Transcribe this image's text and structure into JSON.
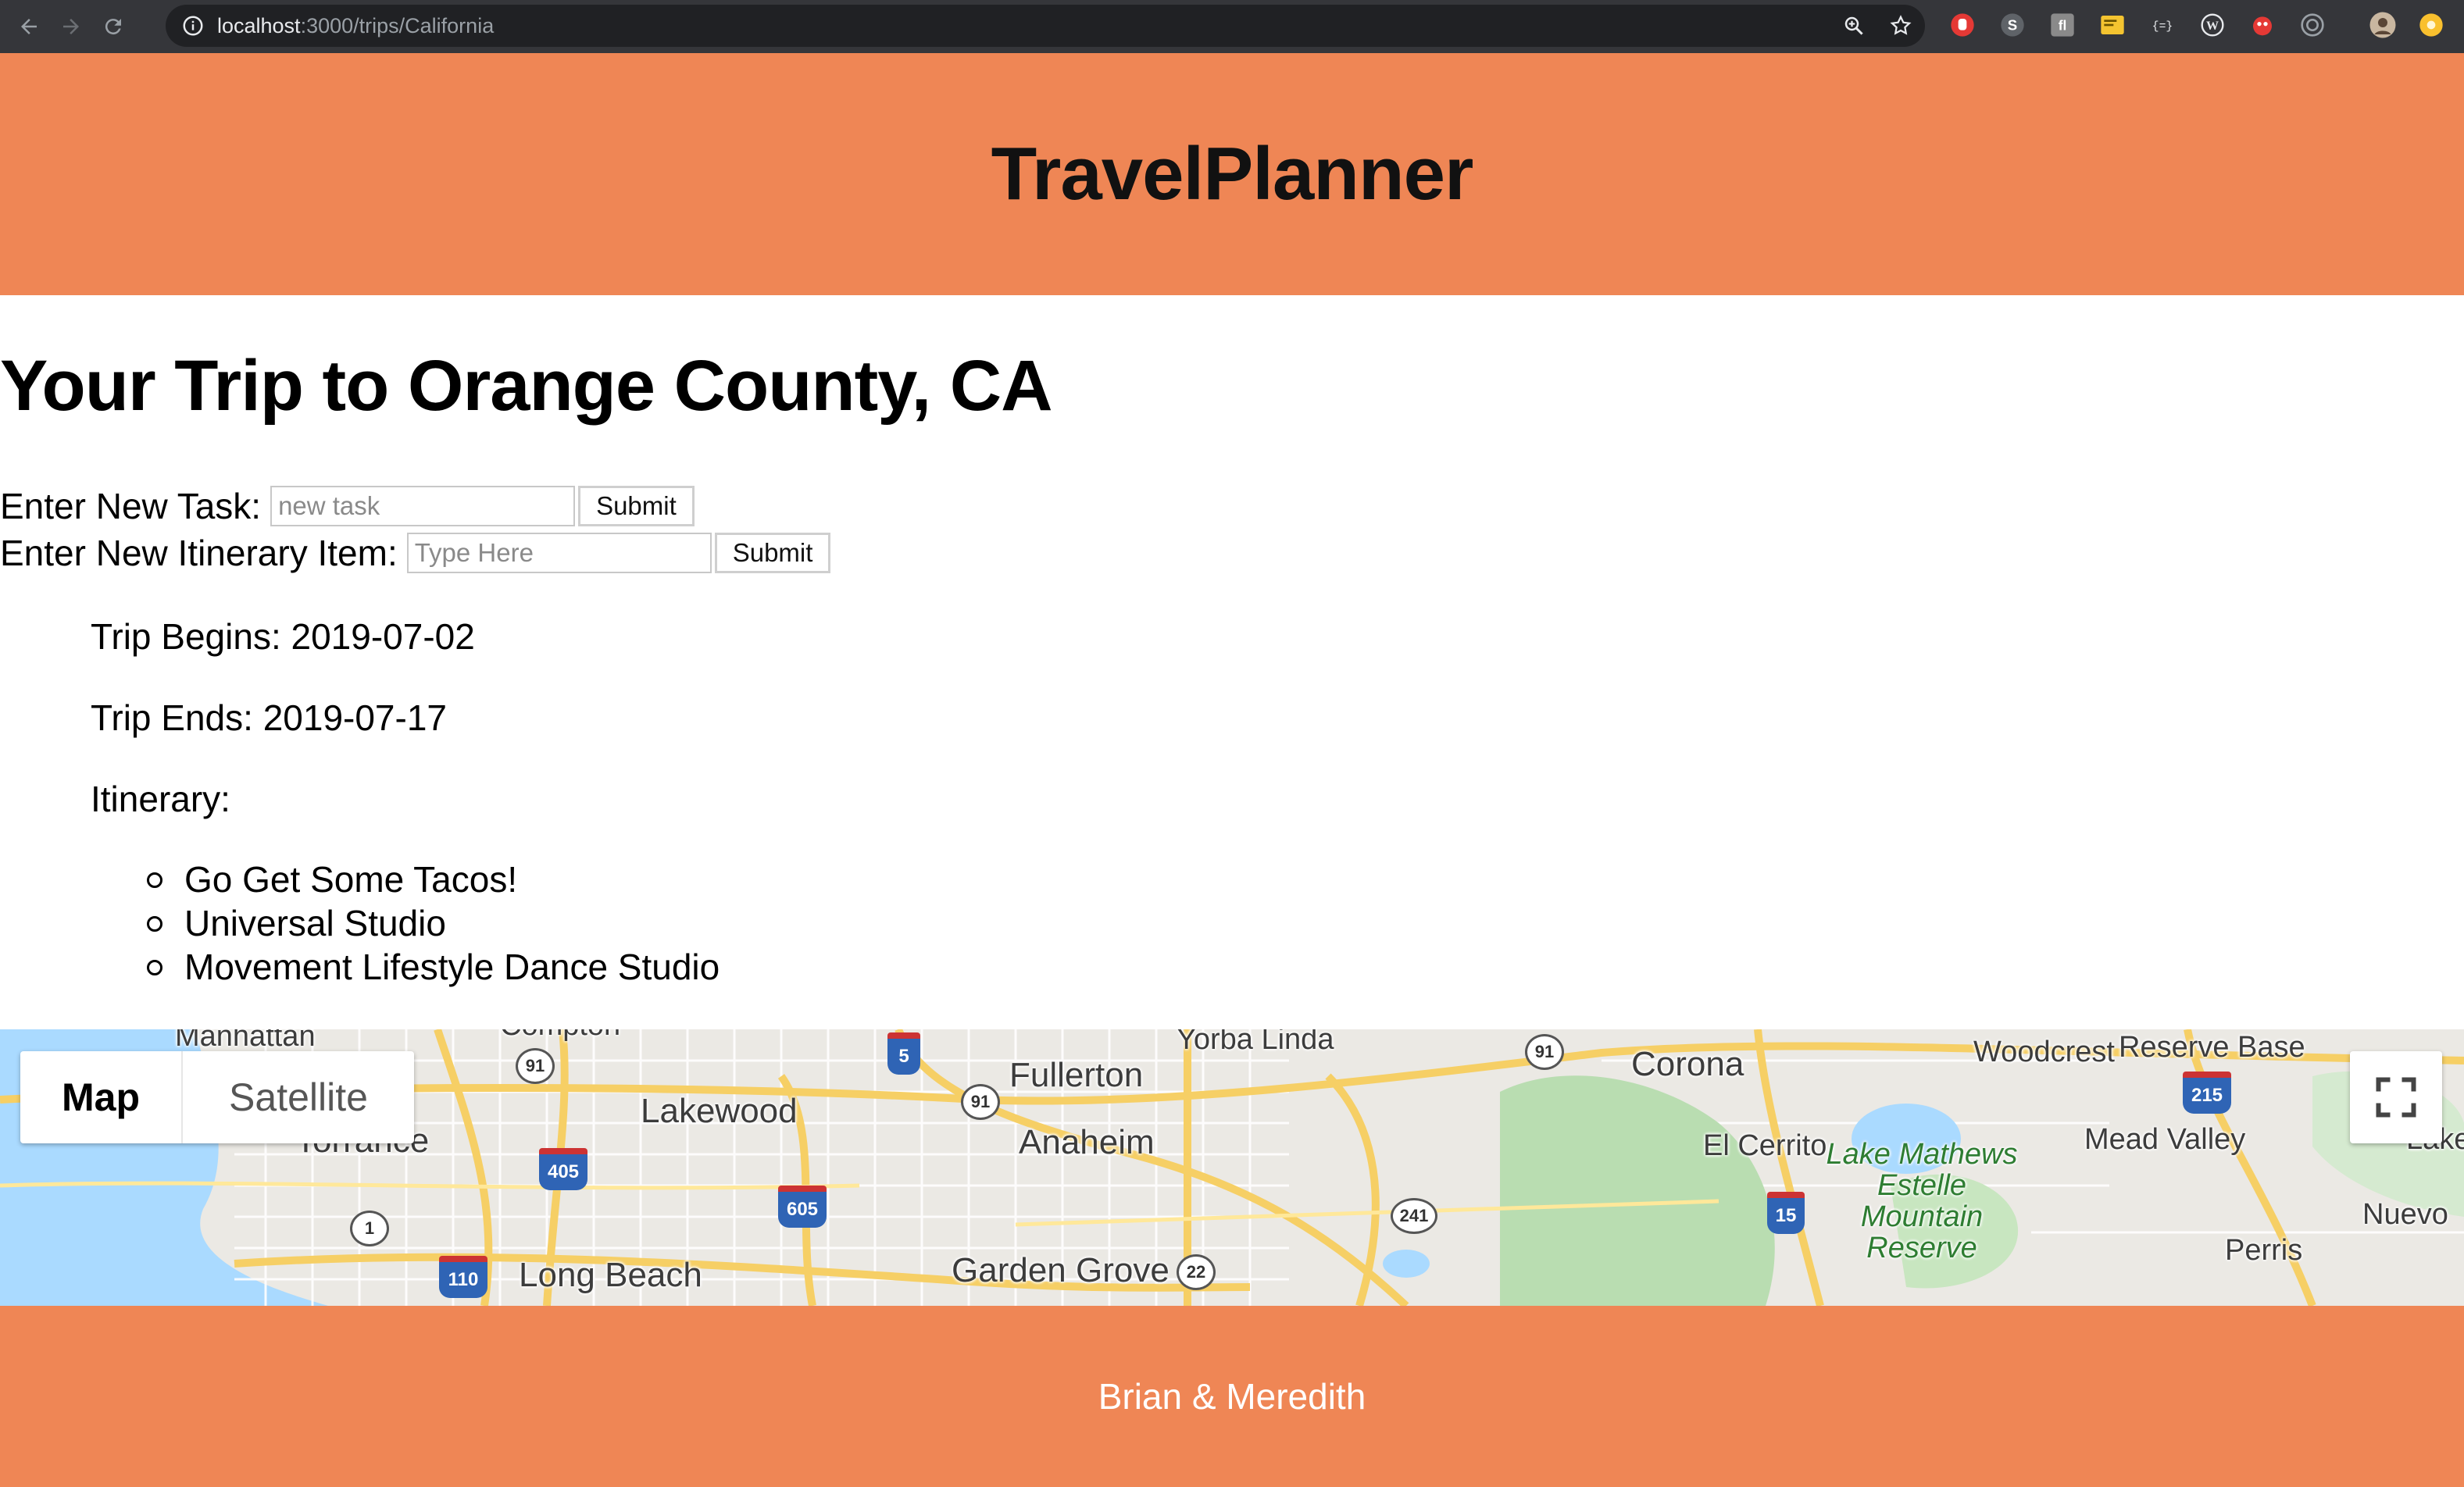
{
  "browser": {
    "url_host": "localhost",
    "url_path": ":3000/trips/California",
    "extensions": [
      {
        "icon": "red-stop-extension-icon",
        "color": "#e53935"
      },
      {
        "icon": "s-extension-icon",
        "color": "#5f6368",
        "label": "S"
      },
      {
        "icon": "fl-extension-icon",
        "color": "#8a8a8a"
      },
      {
        "icon": "yellow-note-extension-icon",
        "color": "#f4c430"
      },
      {
        "icon": "json-extension-icon",
        "color": "#9aa0a6",
        "label": "{=}"
      },
      {
        "icon": "w-extension-icon",
        "color": "#9aa0a6",
        "label": "W"
      },
      {
        "icon": "red-bug-extension-icon",
        "color": "#e53935"
      },
      {
        "icon": "target-extension-icon",
        "color": "#9aa0a6"
      },
      {
        "icon": "profile-avatar-icon",
        "color": "#c9b7a0"
      },
      {
        "icon": "yellow-circle-extension-icon",
        "color": "#f9c02e"
      }
    ]
  },
  "header": {
    "brand": "TravelPlanner",
    "color": "#ef8655"
  },
  "trip": {
    "title": "Your Trip to Orange County, CA",
    "task_form": {
      "label": "Enter New Task:",
      "placeholder": "new task",
      "submit_label": "Submit"
    },
    "itinerary_form": {
      "label": "Enter New Itinerary Item:",
      "placeholder": "Type Here",
      "submit_label": "Submit"
    },
    "begins": "Trip Begins: 2019-07-02",
    "ends": "Trip Ends: 2019-07-17",
    "itinerary_heading": "Itinerary:",
    "itinerary": [
      "Go Get Some Tacos!",
      "Universal Studio",
      "Movement Lifestyle Dance Studio"
    ]
  },
  "map": {
    "type_map_label": "Map",
    "type_satellite_label": "Satellite",
    "places": {
      "manhattan": "Manhattan",
      "compton": "Compton",
      "torrance": "Torrance",
      "lakewood": "Lakewood",
      "long_beach": "Long Beach",
      "yorba_linda": "Yorba Linda",
      "fullerton": "Fullerton",
      "anaheim": "Anaheim",
      "garden_grove": "Garden Grove",
      "corona": "Corona",
      "woodcrest": "Woodcrest",
      "reserve_base": "Reserve Base",
      "el_cerrito": "El Cerrito",
      "lake_mathews": "Lake Mathews Estelle Mountain Reserve",
      "mead_valley": "Mead Valley",
      "lake_el": "Lake El",
      "nuevo": "Nuevo",
      "perris": "Perris"
    },
    "shields": {
      "r91a": "91",
      "r5": "5",
      "r91b": "91",
      "r91c": "91",
      "r405": "405",
      "r605": "605",
      "r1": "1",
      "r110": "110",
      "r241": "241",
      "r22": "22",
      "r15": "15",
      "r215": "215"
    }
  },
  "footer": {
    "credit": "Brian & Meredith"
  }
}
